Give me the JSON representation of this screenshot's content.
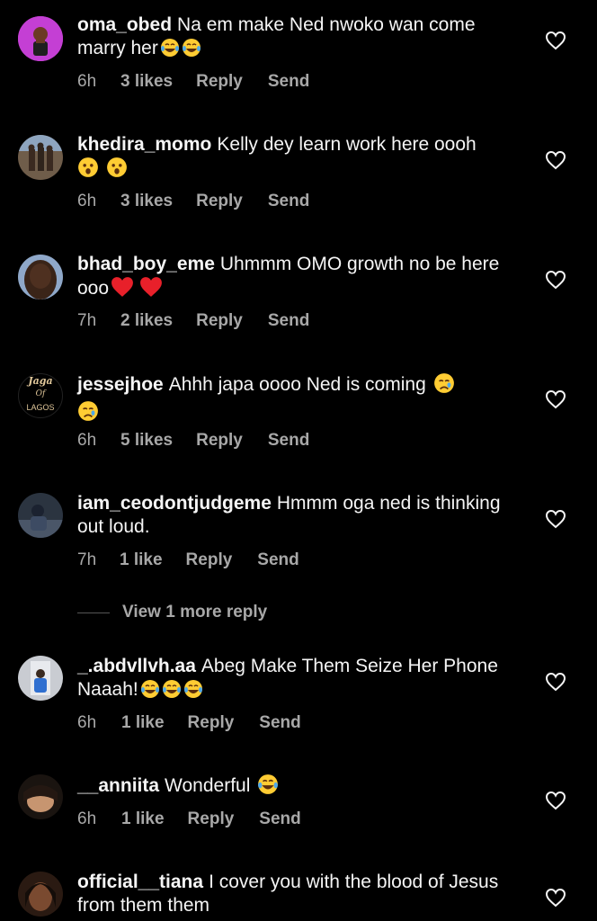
{
  "comments": [
    {
      "username": "oma_obed",
      "text": "Na em make Ned nwoko wan come marry her",
      "emojis": [
        "laughing-tears-emoji",
        "laughing-tears-emoji"
      ],
      "time": "6h",
      "likes": "3 likes",
      "reply": "Reply",
      "send": "Send"
    },
    {
      "username": "khedira_momo",
      "text": "Kelly dey learn work here oooh",
      "emojis": [
        "astonished-emoji",
        "astonished-emoji"
      ],
      "time": "6h",
      "likes": "3 likes",
      "reply": "Reply",
      "send": "Send"
    },
    {
      "username": "bhad_boy_eme",
      "text": "Uhmmm OMO growth no be here ooo",
      "emojis": [
        "red-heart-emoji",
        "red-heart-emoji"
      ],
      "time": "7h",
      "likes": "2 likes",
      "reply": "Reply",
      "send": "Send"
    },
    {
      "username": "jessejhoe",
      "text": "Ahhh japa oooo Ned is coming",
      "emojis": [
        "crying-face-emoji",
        "crying-face-emoji"
      ],
      "time": "6h",
      "likes": "5 likes",
      "reply": "Reply",
      "send": "Send",
      "avatar_text": [
        "Jaga",
        "Of",
        "LAGOS"
      ]
    },
    {
      "username": "iam_ceodontjudgeme",
      "text": "Hmmm oga ned is thinking out loud.",
      "emojis": [],
      "time": "7h",
      "likes": "1 like",
      "reply": "Reply",
      "send": "Send"
    },
    {
      "username": "_.abdvllvh.aa",
      "text": "Abeg Make Them Seize Her Phone Naaah!",
      "emojis": [
        "laughing-tears-emoji",
        "laughing-tears-emoji",
        "laughing-tears-emoji"
      ],
      "time": "6h",
      "likes": "1 like",
      "reply": "Reply",
      "send": "Send"
    },
    {
      "username": "__anniita",
      "text": "Wonderful",
      "emojis": [
        "laughing-tears-emoji"
      ],
      "time": "6h",
      "likes": "1 like",
      "reply": "Reply",
      "send": "Send"
    },
    {
      "username": "official__tiana",
      "text": "I cover you with the blood of Jesus from them them",
      "emojis": []
    }
  ],
  "view_more": "View 1 more reply",
  "colors": {
    "background": "#000000",
    "text": "#f5f5f5",
    "muted": "#a8a8a8"
  }
}
